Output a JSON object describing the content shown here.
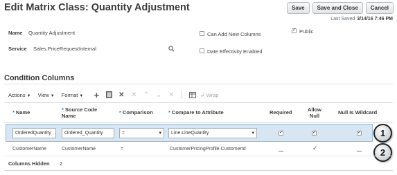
{
  "header": {
    "title": "Edit Matrix Class: Quantity Adjustment",
    "save_label": "Save",
    "save_close_label": "Save and Close",
    "cancel_label": "Cancel",
    "last_saved_label": "Last Saved",
    "last_saved_value": "3/14/16 7:46 PM"
  },
  "form": {
    "name_label": "Name",
    "name_value": "Quantity Adjustment",
    "service_label": "Service",
    "service_value": "Sales.PriceRequestInternal",
    "can_add_new_columns": {
      "label": "Can Add New Columns",
      "checked": false
    },
    "date_effectivity": {
      "label": "Date Effectivity Enabled",
      "checked": false
    },
    "public": {
      "label": "Public",
      "checked": true
    }
  },
  "section": {
    "title": "Condition Columns"
  },
  "toolbar": {
    "actions": "Actions",
    "view": "View",
    "format": "Format",
    "wrap": "Wrap",
    "icons": [
      "add-icon",
      "edit-icon",
      "delete-icon",
      "cut-icon",
      "move-up-icon",
      "move-down-icon",
      "collapse-icon",
      "freeze-icon",
      "wrap-icon"
    ]
  },
  "table": {
    "headers": {
      "name": "Name",
      "source_code": "Source Code Name",
      "comparison": "Comparison",
      "compare_to": "Compare to Attribute",
      "required": "Required",
      "allow_null": "Allow Null",
      "null_wildcard": "Null Is Wildcard"
    },
    "rows": [
      {
        "name": "OrderedQuantity",
        "source_code": "Ordered_Quantity",
        "comparison": "=",
        "compare_to": "Line.LineQuantity",
        "required": true,
        "allow_null": true,
        "null_wildcard": true,
        "callout": "1"
      },
      {
        "name": "CustomerName",
        "source_code": "CustomerName",
        "comparison": "=",
        "compare_to": "CustomerPricingProfile.CustomerId",
        "required": false,
        "allow_null": true,
        "null_wildcard": false,
        "callout": "2"
      }
    ]
  },
  "footer": {
    "columns_hidden_label": "Columns Hidden",
    "columns_hidden_value": "2"
  }
}
